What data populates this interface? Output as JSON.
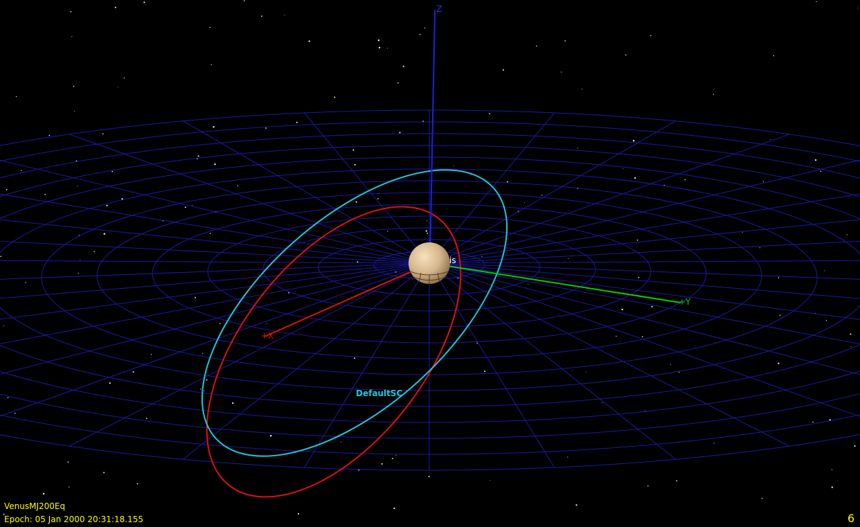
{
  "view": {
    "coordinate_system": "VenusMJ200Eq",
    "epoch": "Epoch: 05 Jan 2000 20:31:18.155",
    "corner_indicator": "6"
  },
  "axes": {
    "z_label": "Z",
    "y_label": "+Y",
    "x_label": "+X"
  },
  "bodies": {
    "central_body_label": "is"
  },
  "spacecraft": {
    "name": "DefaultSC"
  },
  "colors": {
    "background": "#000000",
    "grid": "#1a1aa8",
    "z_axis": "#2020e0",
    "y_axis": "#00d000",
    "x_axis": "#e01010",
    "spacecraft_orbit": "#20c8e0",
    "red_orbit": "#e01010",
    "hud_text": "#ffff00"
  }
}
